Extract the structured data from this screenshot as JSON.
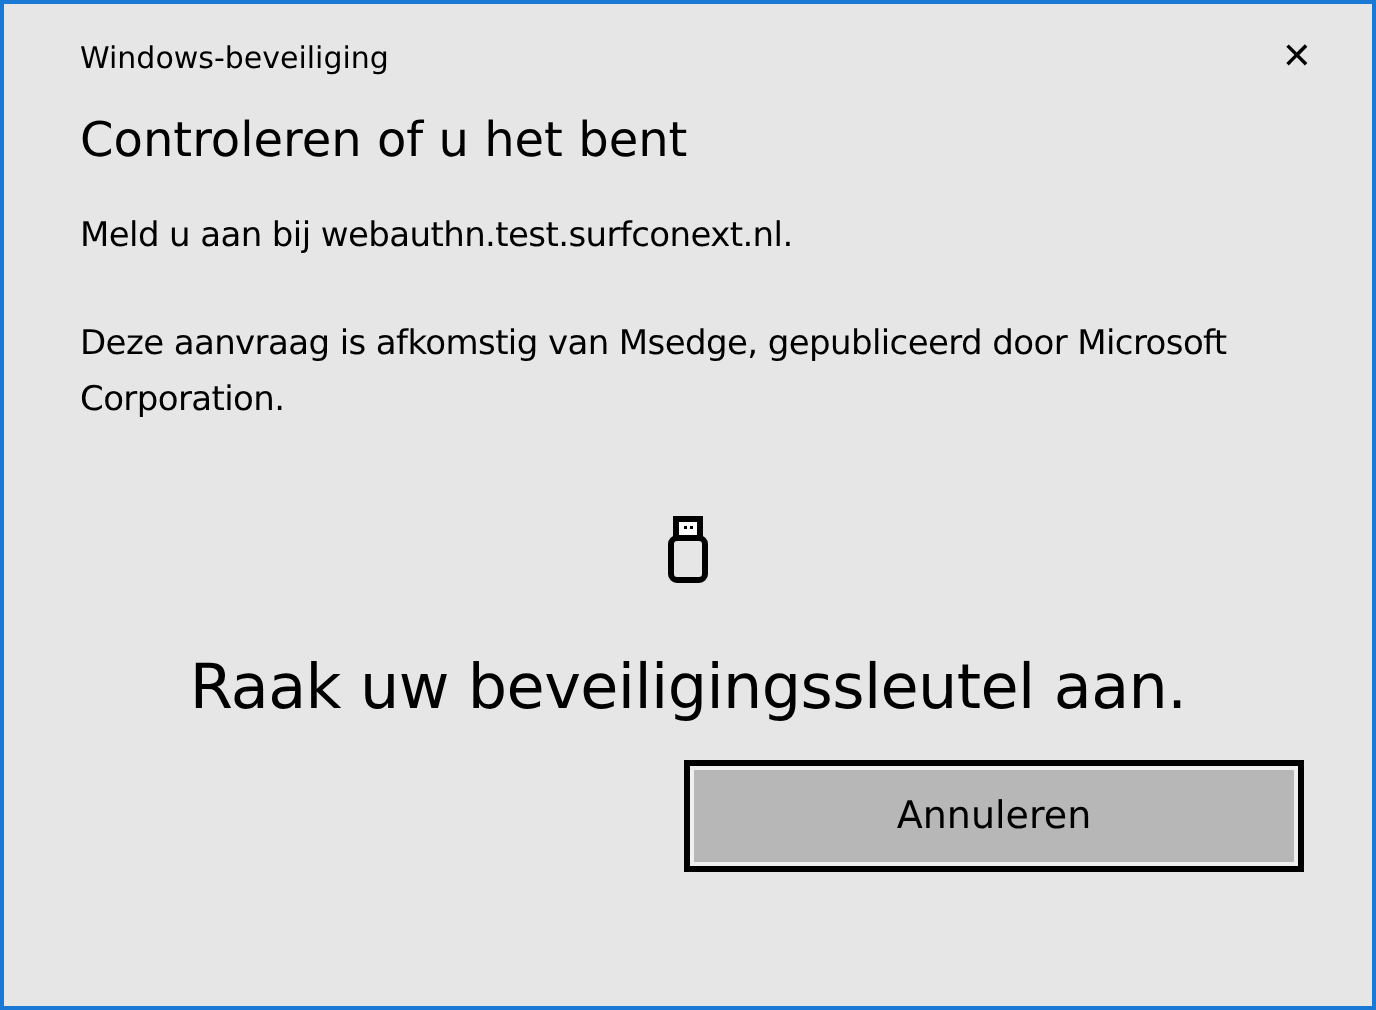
{
  "window": {
    "title": "Windows-beveiliging",
    "close": "✕"
  },
  "heading": "Controleren of u het bent",
  "paragraphs": [
    "Meld u aan bij webauthn.test.surfconext.nl.",
    "Deze aanvraag is afkomstig van Msedge, gepubliceerd door Microsoft Corporation."
  ],
  "prompt": "Raak uw beveiligingssleutel aan.",
  "buttons": [
    {
      "label": "Annuleren",
      "focused": true
    }
  ]
}
